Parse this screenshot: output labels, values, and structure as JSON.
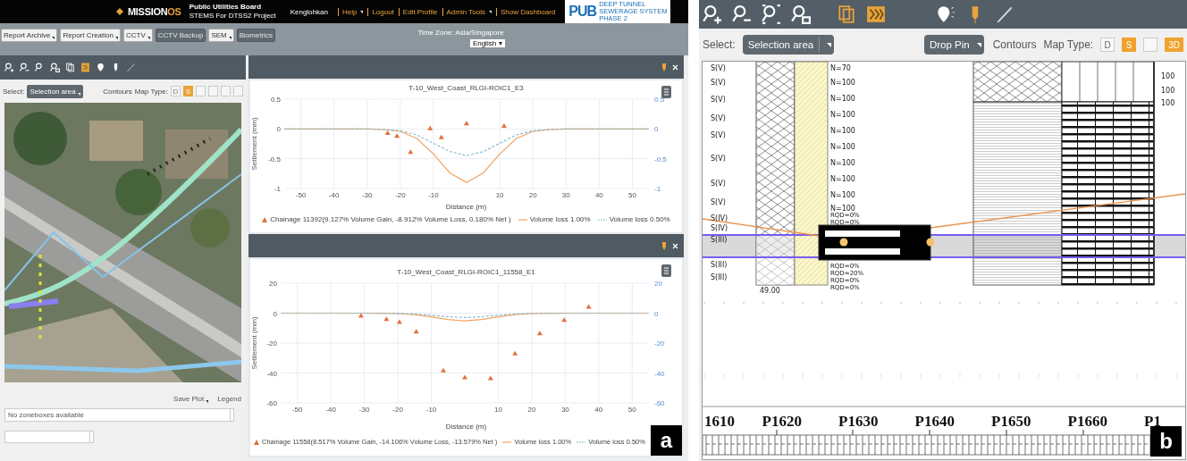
{
  "panel_a": {
    "header": {
      "logo": {
        "text": "MISSION",
        "suffix": "OS"
      },
      "org": {
        "name": "Public Utilities Board",
        "project": "STEMS For DTSS2 Project"
      },
      "user": "Kenglohkan",
      "links": [
        {
          "label": "Help",
          "dropdown": true
        },
        {
          "label": "Logout",
          "dropdown": false
        },
        {
          "label": "Edit Profile",
          "dropdown": false
        },
        {
          "label": "Admin Tools",
          "dropdown": true
        },
        {
          "label": "Show Dashboard",
          "dropdown": false
        }
      ],
      "brand": {
        "name": "PUB",
        "tagline": [
          "DEEP TUNNEL",
          "SEWERAGE SYSTEM",
          "PHASE 2"
        ]
      }
    },
    "menu": [
      {
        "label": "Report Archive",
        "dropdown": true
      },
      {
        "label": "Report Creation",
        "dropdown": true
      },
      {
        "label": "CCTV",
        "dropdown": true
      },
      {
        "label": "CCTV Backup",
        "dropdown": false
      },
      {
        "label": "SEM",
        "dropdown": true
      },
      {
        "label": "Biometrics",
        "dropdown": false
      }
    ],
    "timezone": "Time Zone: Asia/Singapore",
    "language": "English",
    "map_panel": {
      "select_label": "Select:",
      "select_value": "Selection area",
      "contours": "Contours",
      "map_type_label": "Map Type:",
      "map_types": [
        {
          "label": "D",
          "selected": false
        },
        {
          "label": "S",
          "selected": true
        },
        {
          "selected": false
        },
        {
          "selected": false
        },
        {
          "selected": false
        },
        {
          "selected": false
        }
      ],
      "save_plot": "Save Plot",
      "legend": "Legend",
      "zonebox_field": "No zoneboxes available"
    },
    "charts": [
      {
        "chart_data": {
          "type": "line",
          "grid": true,
          "legend": true,
          "title": "T-10_West_Coast_RLGI-ROIC1_E3",
          "xlabel": "Distance (m)",
          "ylabel": "Settlement (mm)",
          "xlim": [
            -55,
            55
          ],
          "ylim": [
            -1,
            0.5
          ],
          "y2lim": [
            -1,
            0.5
          ],
          "xticks": [
            -50,
            -40,
            -30,
            -20,
            -10,
            10,
            20,
            30,
            40,
            50
          ],
          "yticks": [
            0.5,
            0,
            -0.5,
            -1
          ],
          "y2ticks": [
            0.5,
            0,
            -0.5,
            -1
          ],
          "x": [
            -55,
            -50,
            -45,
            -40,
            -35,
            -30,
            -25,
            -20,
            -15,
            -10,
            -5,
            0,
            5,
            10,
            15,
            20,
            25,
            30,
            35,
            40,
            45,
            50,
            55
          ],
          "series": [
            {
              "name": "Chainage 11392(9.127% Volume Gain, -8.912% Volume Loss, 0.180% Net )",
              "color": "#e0703a",
              "type": "scatter",
              "x": [
                -23.8,
                -21,
                -16.9,
                -11,
                -7.6,
                0,
                11.3
              ],
              "values": [
                -0.07,
                -0.12,
                -0.39,
                0.01,
                -0.14,
                0.09,
                0.05
              ]
            },
            {
              "name": "Volume loss 1.00%",
              "color": "#f3a35e",
              "type": "line",
              "line_style": "solid",
              "values": [
                0,
                0,
                0,
                0,
                0,
                0,
                -0.01,
                -0.04,
                -0.16,
                -0.42,
                -0.74,
                -0.9,
                -0.74,
                -0.42,
                -0.16,
                -0.04,
                -0.01,
                0,
                0,
                0,
                0,
                0,
                0
              ]
            },
            {
              "name": "Volume loss 0.50%",
              "color": "#86bccf",
              "type": "line",
              "line_style": "dashed",
              "values": [
                0,
                0,
                0,
                0,
                0,
                0,
                -0.01,
                -0.03,
                -0.1,
                -0.24,
                -0.38,
                -0.45,
                -0.38,
                -0.24,
                -0.1,
                -0.03,
                -0.01,
                0,
                0,
                0,
                0,
                0,
                0
              ]
            }
          ]
        }
      },
      {
        "chart_data": {
          "type": "line",
          "grid": true,
          "legend": true,
          "title": "T-10_West_Coast_RLGI-ROIC1_11558_E1",
          "xlabel": "Distance (m)",
          "ylabel": "Settlement (mm)",
          "xlim": [
            -55,
            55
          ],
          "ylim": [
            -60,
            20
          ],
          "y2lim": [
            -60,
            20
          ],
          "xticks": [
            -50,
            -40,
            -30,
            -20,
            -10,
            10,
            20,
            30,
            40,
            50
          ],
          "yticks": [
            20,
            0,
            -20,
            -40,
            -60
          ],
          "y2ticks": [
            20,
            0,
            -20,
            -40,
            -60
          ],
          "x": [
            -55,
            -50,
            -45,
            -40,
            -35,
            -30,
            -25,
            -20,
            -15,
            -10,
            -5,
            0,
            5,
            10,
            15,
            20,
            25,
            30,
            35,
            40,
            45,
            50,
            55
          ],
          "series": [
            {
              "name": "Chainage 11558(8.517% Volume Gain, -14.106% Volume Loss, -13.579% Net )",
              "color": "#e0703a",
              "type": "scatter",
              "x": [
                -31,
                -23.4,
                -19.5,
                -14.5,
                -6.4,
                0,
                7.7,
                15,
                22.4,
                29.7,
                37
              ],
              "values": [
                -1.8,
                -4,
                -6,
                -12.4,
                -38.4,
                -43,
                -43.6,
                -27,
                -13.6,
                -4.6,
                4.2
              ]
            },
            {
              "name": "Volume loss 1.00%",
              "color": "#f3a35e",
              "type": "line",
              "line_style": "solid",
              "values": [
                0,
                0,
                0,
                0,
                0,
                0,
                -0.1,
                -0.3,
                -1,
                -2.5,
                -4.3,
                -5.2,
                -4.3,
                -2.5,
                -1,
                -0.3,
                -0.1,
                0,
                0,
                0,
                0,
                0,
                0
              ]
            },
            {
              "name": "Volume loss 0.50%",
              "color": "#86bccf",
              "type": "line",
              "line_style": "dashed",
              "values": [
                0,
                0,
                0,
                0,
                0,
                0,
                -0.1,
                -0.2,
                -0.6,
                -1.4,
                -2.4,
                -2.9,
                -2.4,
                -1.4,
                -0.6,
                -0.2,
                -0.1,
                0,
                0,
                0,
                0,
                0,
                0
              ]
            }
          ]
        }
      }
    ]
  },
  "panel_b": {
    "select_label": "Select:",
    "select_value": "Selection area",
    "drop_pin": "Drop Pin",
    "contours": "Contours",
    "map_type_label": "Map Type:",
    "map_types": [
      {
        "label": "D",
        "selected": false
      },
      {
        "label": "S",
        "selected": true
      },
      {
        "selected": false
      },
      {
        "label": "3D",
        "selected": true
      }
    ],
    "section": {
      "layer_labels": [
        "S(V)",
        "S(V)",
        "S(V)",
        "S(V)",
        "S(V)",
        "S(V)",
        "S(V)",
        "S(V)",
        "S(IV)",
        "S(IV)",
        "S(III)",
        "S(III)",
        "S(III)"
      ],
      "spt_values": [
        "N=70",
        "N=100",
        "N=100",
        "N=100",
        "N=100",
        "N=100",
        "N=100",
        "N=100",
        "N=100",
        "N=100"
      ],
      "rqd_values": [
        "RQD=0%",
        "RQD=0%",
        "RQD=0%",
        "RQD=20%",
        "RQD=0%",
        "RQD=0%"
      ],
      "depth": "49.00",
      "scale_values": [
        "100",
        "100",
        "100"
      ],
      "chainages": [
        "1610",
        "P1620",
        "P1630",
        "P1640",
        "P1650",
        "P1660",
        "P1"
      ]
    }
  },
  "panel_labels": [
    "a",
    "b"
  ]
}
